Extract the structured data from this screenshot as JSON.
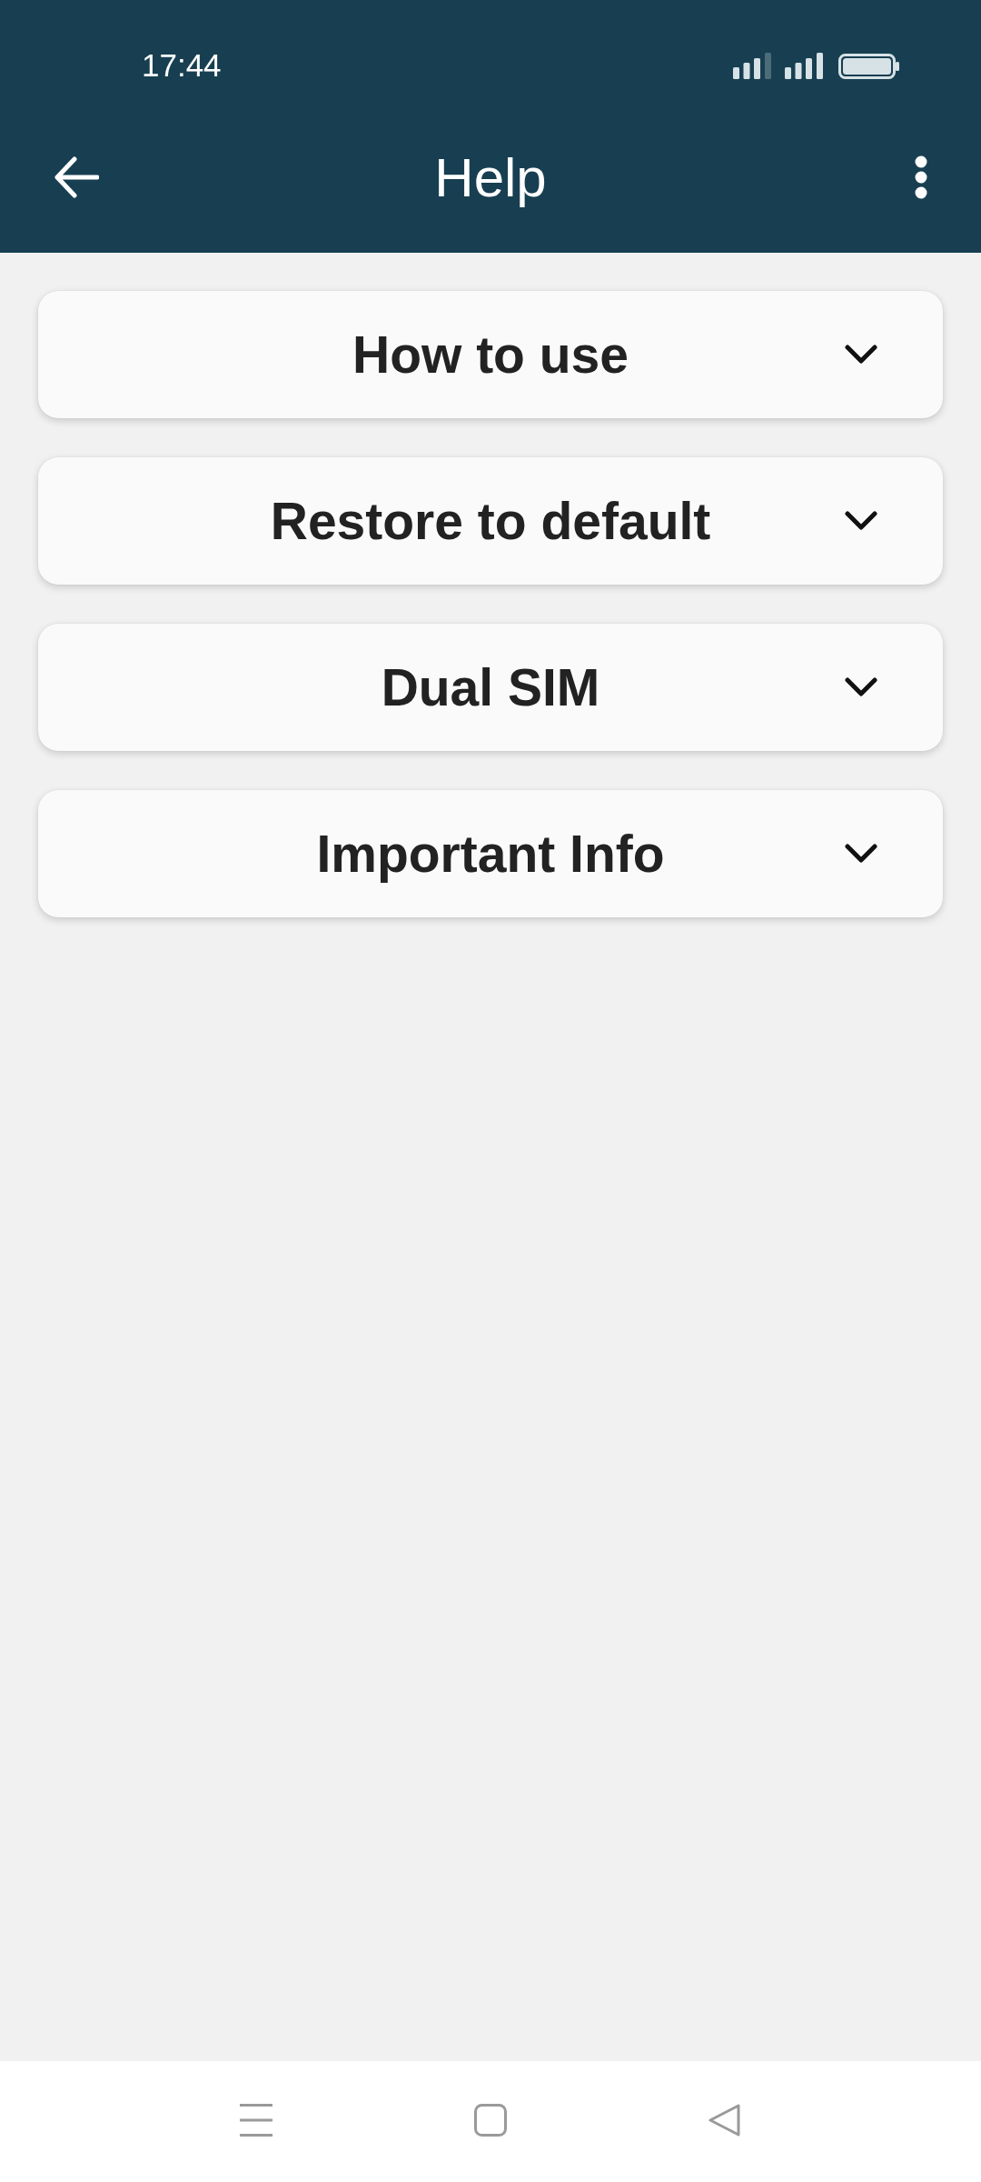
{
  "status_bar": {
    "time": "17:44"
  },
  "app_bar": {
    "title": "Help"
  },
  "sections": [
    {
      "title": "How to use",
      "expanded": false
    },
    {
      "title": "Restore to default",
      "expanded": false
    },
    {
      "title": "Dual SIM",
      "expanded": false
    },
    {
      "title": "Important Info",
      "expanded": false
    }
  ]
}
